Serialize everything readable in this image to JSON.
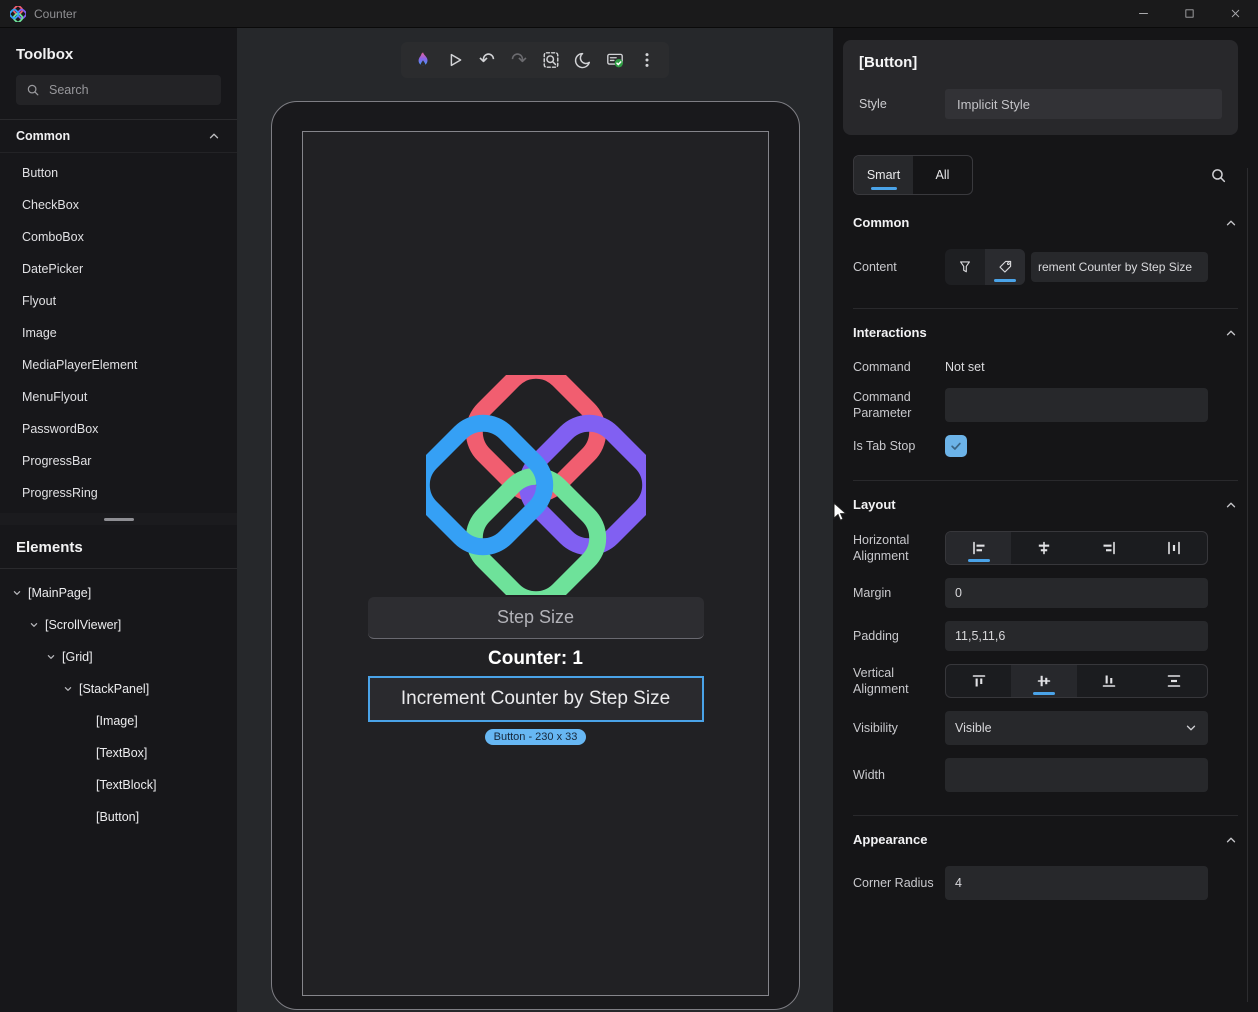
{
  "colors": {
    "accent": "#4AA3E8",
    "badge_bg": "#67B7F3",
    "status_green": "#2F9E44",
    "logo_red": "#F15E70",
    "logo_blue": "#35A0F5",
    "logo_purple": "#8160F2",
    "logo_green": "#6EE29A"
  },
  "window": {
    "title": "Counter"
  },
  "toolbox": {
    "title": "Toolbox",
    "search_placeholder": "Search",
    "section_label": "Common",
    "items": [
      "Button",
      "CheckBox",
      "ComboBox",
      "DatePicker",
      "Flyout",
      "Image",
      "MediaPlayerElement",
      "MenuFlyout",
      "PasswordBox",
      "ProgressBar",
      "ProgressRing"
    ]
  },
  "elements": {
    "title": "Elements",
    "tree": [
      {
        "label": "[MainPage]",
        "depth": 0,
        "expandable": true
      },
      {
        "label": "[ScrollViewer]",
        "depth": 1,
        "expandable": true
      },
      {
        "label": "[Grid]",
        "depth": 2,
        "expandable": true
      },
      {
        "label": "[StackPanel]",
        "depth": 3,
        "expandable": true
      },
      {
        "label": "[Image]",
        "depth": 4,
        "expandable": false
      },
      {
        "label": "[TextBox]",
        "depth": 4,
        "expandable": false
      },
      {
        "label": "[TextBlock]",
        "depth": 4,
        "expandable": false
      },
      {
        "label": "[Button]",
        "depth": 4,
        "expandable": false
      }
    ]
  },
  "toolbar": {
    "buttons": [
      {
        "name": "hot-reload",
        "icon": "flame",
        "disabled": false
      },
      {
        "name": "play",
        "icon": "play",
        "disabled": false
      },
      {
        "name": "undo",
        "icon": "undo",
        "disabled": false
      },
      {
        "name": "redo",
        "icon": "redo",
        "disabled": true
      },
      {
        "name": "inspect-element",
        "icon": "inspect",
        "disabled": false
      },
      {
        "name": "theme-toggle",
        "icon": "moon",
        "disabled": false
      },
      {
        "name": "devtools-status",
        "icon": "devtools",
        "disabled": false
      },
      {
        "name": "more-options",
        "icon": "kebab",
        "disabled": false
      }
    ]
  },
  "app_preview": {
    "textbox_placeholder": "Step Size",
    "counter_text": "Counter: 1",
    "button_label": "Increment Counter by Step Size",
    "selection_badge": "Button - 230 x 33"
  },
  "inspector": {
    "header": {
      "title": "[Button]",
      "style_label": "Style",
      "style_value": "Implicit Style"
    },
    "tabs": [
      {
        "label": "Smart"
      },
      {
        "label": "All"
      }
    ],
    "common": {
      "title": "Common",
      "content_label": "Content",
      "content_value": "rement Counter by Step Size"
    },
    "interactions": {
      "title": "Interactions",
      "command_label": "Command",
      "command_value": "Not set",
      "command_parameter_label": "Command Parameter",
      "command_parameter_value": "",
      "is_tab_stop_label": "Is Tab Stop",
      "is_tab_stop_checked": true
    },
    "layout": {
      "title": "Layout",
      "horizontal_alignment_label": "Horizontal Alignment",
      "horizontal_alignment_selected": "left",
      "margin_label": "Margin",
      "margin_value": "0",
      "padding_label": "Padding",
      "padding_value": "11,5,11,6",
      "vertical_alignment_label": "Vertical Alignment",
      "vertical_alignment_selected": "center",
      "visibility_label": "Visibility",
      "visibility_value": "Visible",
      "width_label": "Width",
      "width_value": ""
    },
    "appearance": {
      "title": "Appearance",
      "corner_radius_label": "Corner Radius",
      "corner_radius_value": "4"
    }
  }
}
